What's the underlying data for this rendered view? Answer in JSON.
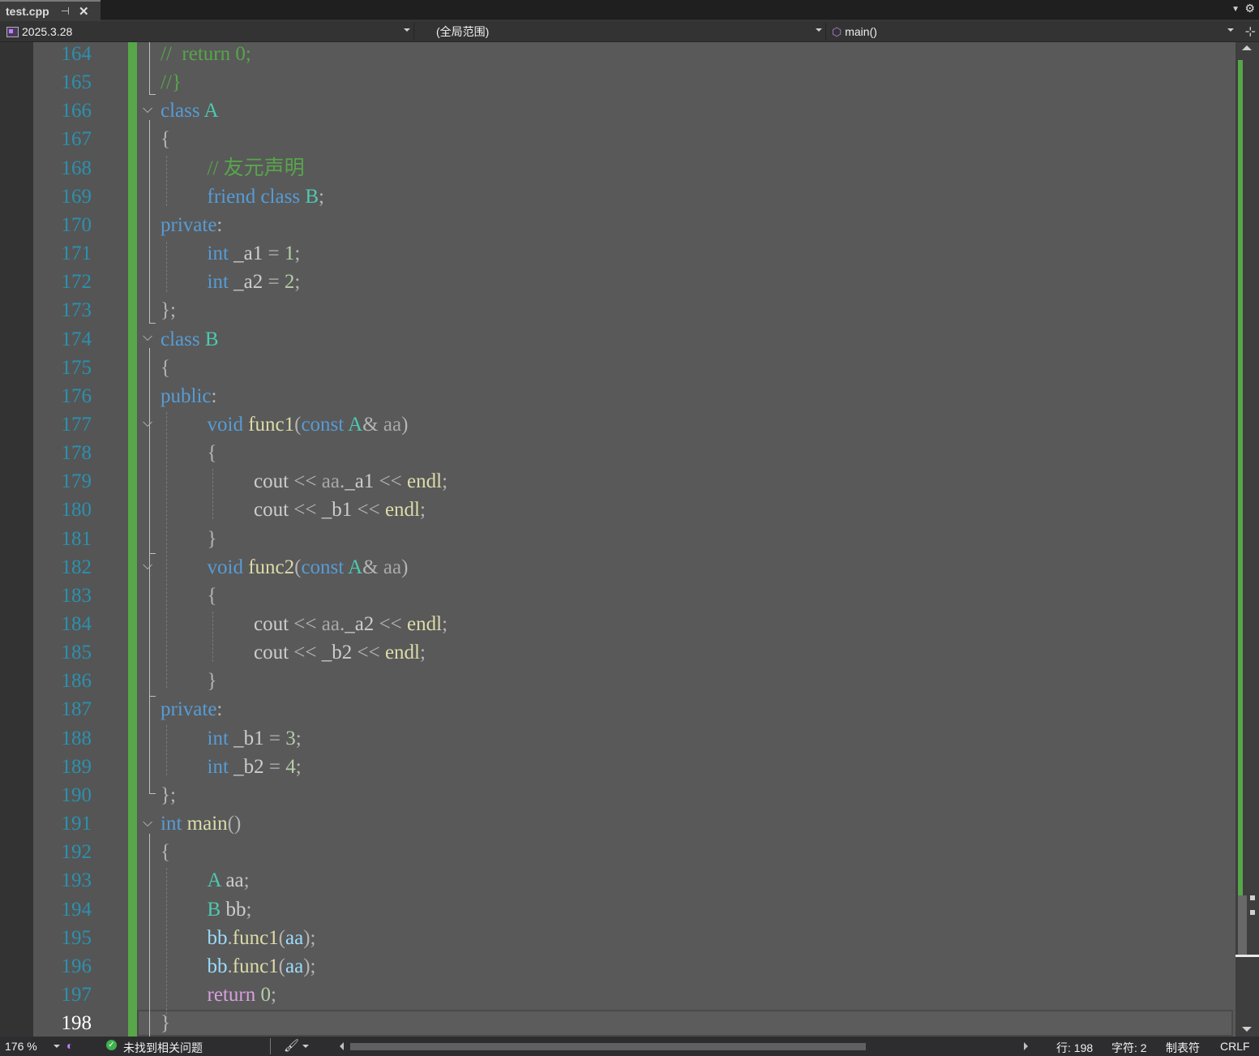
{
  "tab": {
    "title": "test.cpp",
    "pin_icon": "pin-icon",
    "close_icon": "close-icon"
  },
  "navbar": {
    "project": "2025.3.28",
    "scope": "(全局范围)",
    "member": "main()"
  },
  "editor": {
    "line_numbers": [
      "164",
      "165",
      "166",
      "167",
      "168",
      "169",
      "170",
      "171",
      "172",
      "173",
      "174",
      "175",
      "176",
      "177",
      "178",
      "179",
      "180",
      "181",
      "182",
      "183",
      "184",
      "185",
      "186",
      "187",
      "188",
      "189",
      "190",
      "191",
      "192",
      "193",
      "194",
      "195",
      "196",
      "197",
      "198"
    ],
    "current_line": "198",
    "code": {
      "l164": [
        "//  return 0;"
      ],
      "l165": [
        "//}"
      ],
      "l166": [
        "class",
        " ",
        "A"
      ],
      "l167": [
        "{"
      ],
      "l168": [
        "// 友元声明"
      ],
      "l169": [
        "friend",
        " ",
        "class",
        " ",
        "B",
        ";"
      ],
      "l170": [
        "private",
        ":"
      ],
      "l171": [
        "int",
        " _a1 ",
        "=",
        " ",
        "1",
        ";"
      ],
      "l172": [
        "int",
        " _a2 ",
        "=",
        " ",
        "2",
        ";"
      ],
      "l173": [
        "};"
      ],
      "l174": [
        "class",
        " ",
        "B"
      ],
      "l175": [
        "{"
      ],
      "l176": [
        "public",
        ":"
      ],
      "l177": [
        "void",
        " ",
        "func1",
        "(",
        "const",
        " ",
        "A",
        "&",
        " ",
        "aa",
        ")"
      ],
      "l178": [
        "{"
      ],
      "l179": [
        "cout",
        " << ",
        "aa",
        ".",
        "_a1",
        " << ",
        "endl",
        ";"
      ],
      "l180": [
        "cout",
        " << ",
        "_b1",
        " << ",
        "endl",
        ";"
      ],
      "l181": [
        "}"
      ],
      "l182": [
        "void",
        " ",
        "func2",
        "(",
        "const",
        " ",
        "A",
        "&",
        " ",
        "aa",
        ")"
      ],
      "l183": [
        "{"
      ],
      "l184": [
        "cout",
        " << ",
        "aa",
        ".",
        "_a2",
        " << ",
        "endl",
        ";"
      ],
      "l185": [
        "cout",
        " << ",
        "_b2",
        " << ",
        "endl",
        ";"
      ],
      "l186": [
        "}"
      ],
      "l187": [
        "private",
        ":"
      ],
      "l188": [
        "int",
        " _b1 ",
        "=",
        " ",
        "3",
        ";"
      ],
      "l189": [
        "int",
        " _b2 ",
        "=",
        " ",
        "4",
        ";"
      ],
      "l190": [
        "};"
      ],
      "l191": [
        "int",
        " ",
        "main",
        "()"
      ],
      "l192": [
        "{"
      ],
      "l193": [
        "A",
        " ",
        "aa",
        ";"
      ],
      "l194": [
        "B",
        " ",
        "bb",
        ";"
      ],
      "l195": [
        "bb",
        ".",
        "func1",
        "(",
        "aa",
        ");"
      ],
      "l196": [
        "bb",
        ".",
        "func1",
        "(",
        "aa",
        ");"
      ],
      "l197": [
        "return",
        " ",
        "0",
        ";"
      ],
      "l198": [
        "}"
      ]
    }
  },
  "statusbar": {
    "zoom": "176 %",
    "issues": "未找到相关问题",
    "line": "行: 198",
    "char": "字符: 2",
    "tabs": "制表符",
    "eol": "CRLF"
  },
  "colors": {
    "keyword": "#569cd6",
    "type": "#4ec9b0",
    "function": "#dcdcaa",
    "comment": "#57a64a",
    "number": "#b5cea8",
    "variable": "#9cdcfe",
    "change_bar": "#57a64a",
    "background": "#595959"
  },
  "icons": [
    "pin-icon",
    "close-icon",
    "tab-dropdown-icon",
    "settings-gear-icon",
    "project-icon",
    "member-icon",
    "split-view-icon",
    "copilot-icon",
    "check-icon",
    "brush-icon"
  ]
}
